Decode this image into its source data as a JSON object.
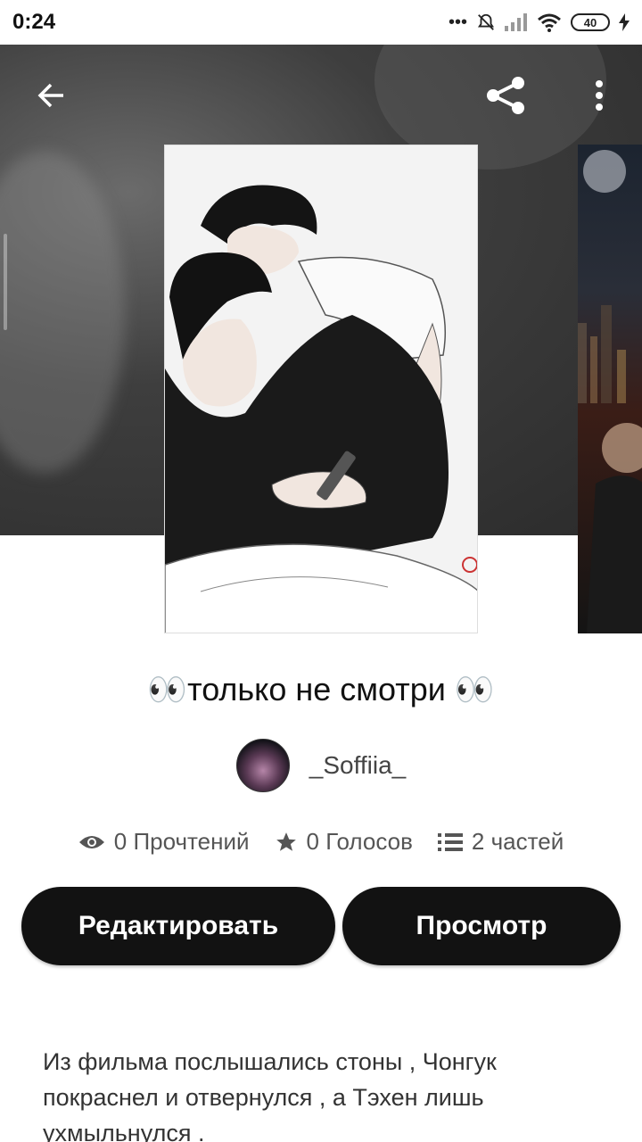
{
  "status_bar": {
    "time": "0:24",
    "dots": "•••",
    "battery": "40"
  },
  "header": {
    "back_icon": "arrow-left-icon",
    "share_icon": "share-icon",
    "more_icon": "more-vert-icon"
  },
  "story": {
    "title": "👀только не смотри 👀",
    "author": "_Soffiia_",
    "stats": {
      "reads": "0 Прочтений",
      "votes": "0 Голосов",
      "parts": "2 частей"
    },
    "buttons": {
      "edit": "Редактировать",
      "view": "Просмотр"
    },
    "description": "Из фильма послышались стоны , Чонгук покраснел и отвернулся , а Тэхен лишь ухмыльнулся ."
  },
  "colors": {
    "button_bg": "#121212",
    "hero_bg": "#3e3e3e"
  }
}
